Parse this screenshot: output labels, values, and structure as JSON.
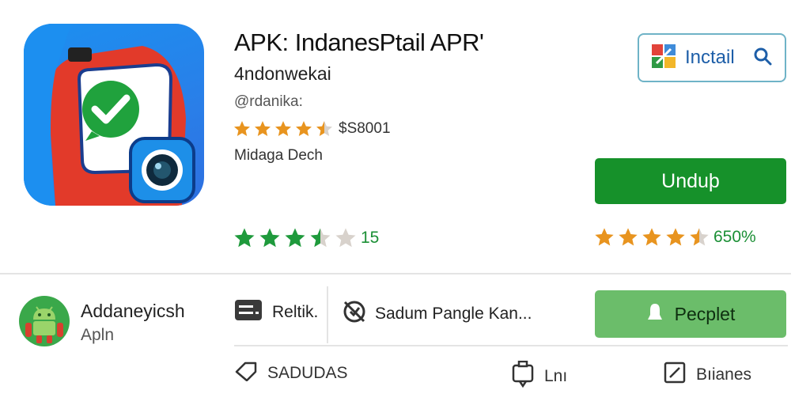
{
  "app": {
    "title": "APK: IndanesPtail APR'",
    "subtitle": "4ndonwekai",
    "developer": "@rdanika:",
    "rating_text": "$S8001",
    "rating_stars": 4.5,
    "category": "Midaga Dech"
  },
  "install": {
    "label": "Inctail",
    "icon": "search-icon"
  },
  "download": {
    "label": "Unduþ"
  },
  "ratings": {
    "green": {
      "value": "15",
      "stars": 3.5,
      "color": "#1f9a3c"
    },
    "orange": {
      "value": "650%",
      "stars": 4.5,
      "color": "#e8941f"
    }
  },
  "related": {
    "title": "Addaneyicsh",
    "subtitle": "Apln",
    "icon": "android-icon"
  },
  "meta": {
    "reitk_label": "Reltik.",
    "sadum_label": "Sadum Pangle Kan..."
  },
  "peoplet": {
    "label": "Pecplet",
    "icon": "person-icon"
  },
  "actions": [
    {
      "label": "SADUDAS",
      "icon": "tag-icon"
    },
    {
      "label": "Lnı",
      "icon": "comment-icon"
    },
    {
      "label": "Bıianes",
      "icon": "edit-icon"
    }
  ],
  "colors": {
    "download_bg": "#16912a",
    "peoplet_bg": "#6bbd6a",
    "install_border": "#6fb3c7",
    "star_orange": "#e8941f",
    "star_green": "#1f9a3c"
  }
}
